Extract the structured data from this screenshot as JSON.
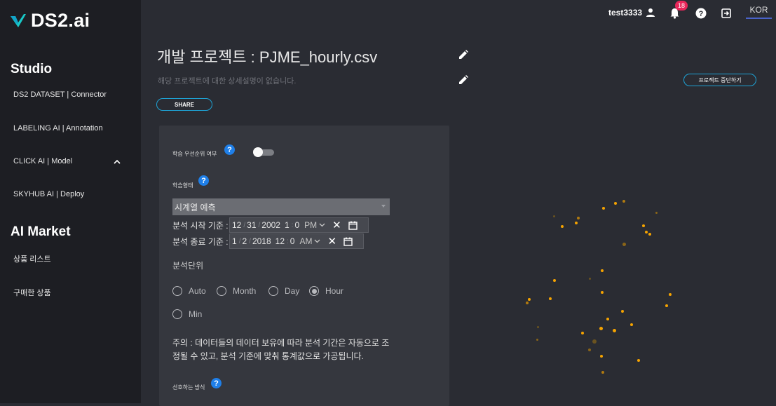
{
  "brand": {
    "name": "DS2.ai"
  },
  "sidebar": {
    "studio_title": "Studio",
    "studio_items": [
      {
        "label": "DS2 DATASET | Connector"
      },
      {
        "label": "LABELING AI | Annotation"
      },
      {
        "label": "CLICK AI | Model"
      },
      {
        "label": "SKYHUB AI | Deploy"
      }
    ],
    "market_title": "AI Market",
    "market_items": [
      {
        "label": "상품 리스트"
      },
      {
        "label": "구매한 상품"
      }
    ]
  },
  "header": {
    "username": "test3333",
    "notification_count": "18",
    "language": "KOR",
    "icons": [
      "user-icon",
      "bell-icon",
      "help-icon",
      "logout-icon"
    ]
  },
  "project": {
    "title": "개발 프로젝트 : PJME_hourly.csv",
    "description": "해당 프로젝트에 대한 상세설명이 없습니다.",
    "share_label": "SHARE",
    "stop_label": "프로젝트 중단하기"
  },
  "settings": {
    "priority_label": "학습 우선순위 여부",
    "priority_enabled": false,
    "training_type_label": "학습형태",
    "training_type_value": "시계열 예측",
    "start_label": "분석 시작 기준 :",
    "start": {
      "month": "12",
      "day": "31",
      "year": "2002",
      "hour": "1",
      "minute": "0",
      "ampm": "PM"
    },
    "end_label": "분석 종료 기준 :",
    "end": {
      "month": "1",
      "day": "2",
      "year": "2018",
      "hour": "12",
      "minute": "0",
      "ampm": "AM"
    },
    "unit_label": "분석단위",
    "units": [
      {
        "label": "Auto",
        "selected": false
      },
      {
        "label": "Month",
        "selected": false
      },
      {
        "label": "Day",
        "selected": false
      },
      {
        "label": "Hour",
        "selected": true
      },
      {
        "label": "Min",
        "selected": false
      }
    ],
    "notice_line1": "주의 : 데이터들의 데이터 보유에 따라 분석 기간은 자동으로 조",
    "notice_line2": "정될 수 있고, 분석 기준에 맞춰 통계값으로 가공됩니다.",
    "preferred_method_label": "선호하는 방식"
  },
  "colors": {
    "accent_blue": "#1f7fe8",
    "share_border": "#1ea3d6",
    "badge": "#e8265a",
    "dot_orange": "#f5a300"
  }
}
